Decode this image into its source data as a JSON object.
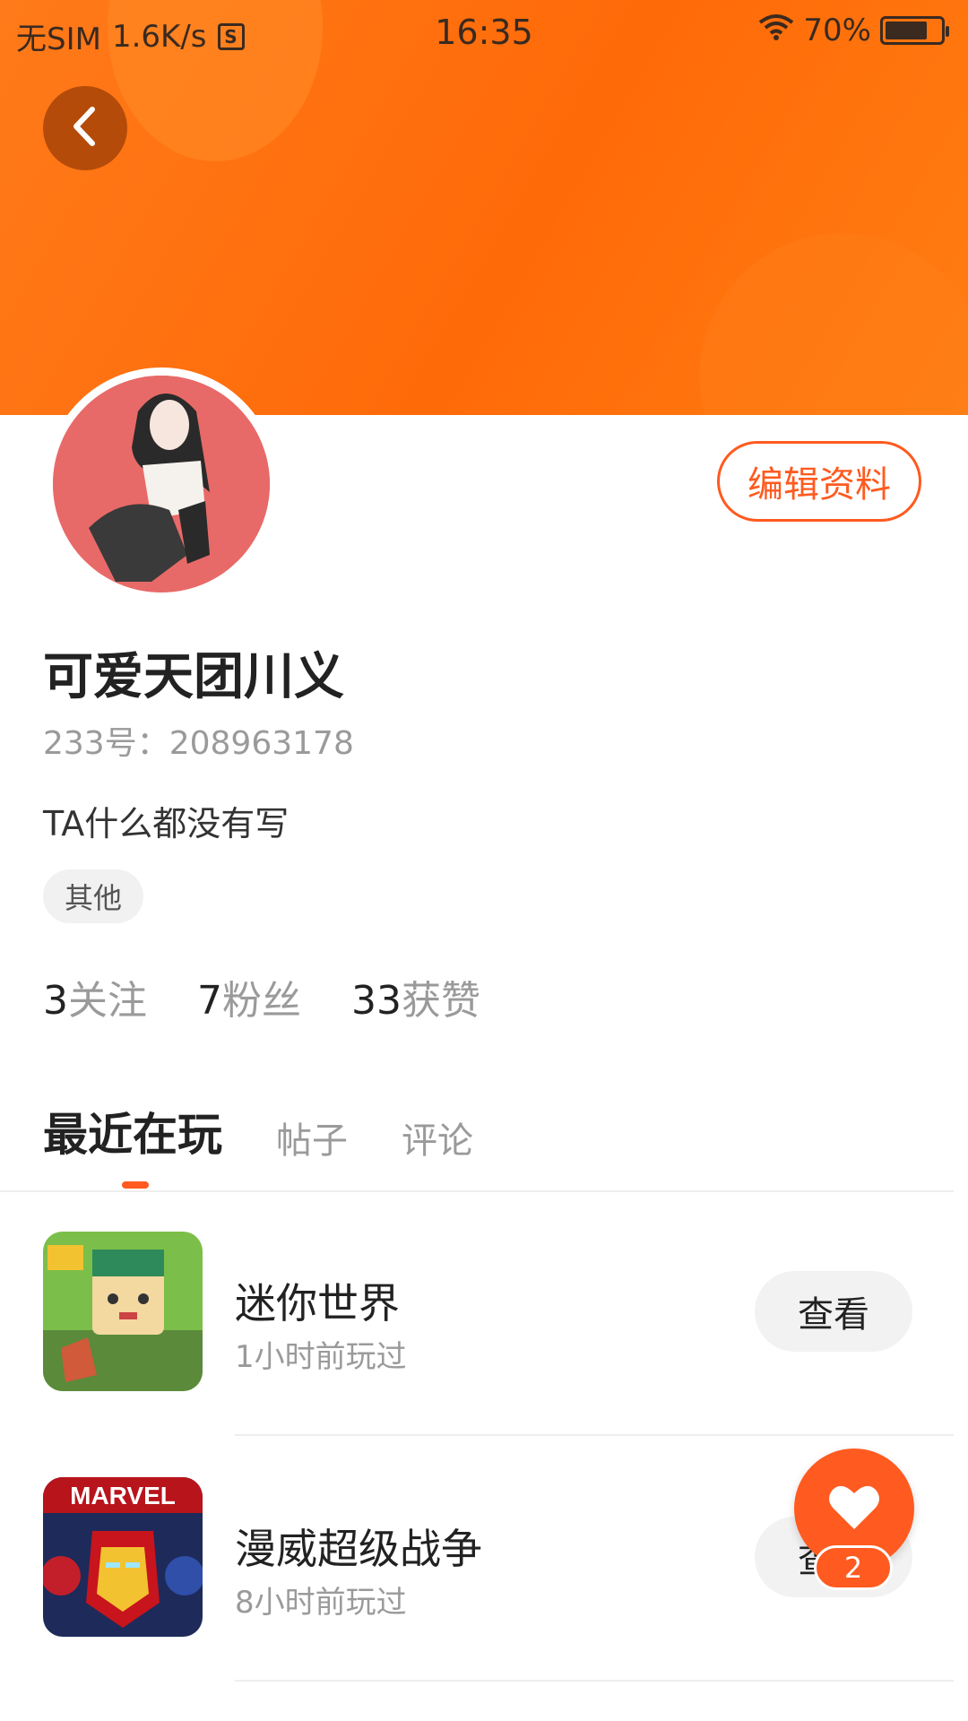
{
  "status_bar": {
    "carrier": "无SIM",
    "speed": "1.6K/s",
    "sim_icon_letter": "S",
    "time": "16:35",
    "battery": "70%",
    "icons": [
      "wifi-icon",
      "battery-icon",
      "sim-icon"
    ]
  },
  "header": {
    "back_icon": "chevron-left-icon",
    "accent_color": "#ff6a08"
  },
  "profile": {
    "edit_label": "编辑资料",
    "username": "可爱天团川义",
    "uid": "233号：208963178",
    "bio": "TA什么都没有写",
    "tag": "其他",
    "stats": [
      {
        "num": "3",
        "label": "关注"
      },
      {
        "num": "7",
        "label": "粉丝"
      },
      {
        "num": "33",
        "label": "获赞"
      }
    ]
  },
  "tabs": [
    {
      "label": "最近在玩",
      "active": true
    },
    {
      "label": "帖子",
      "active": false
    },
    {
      "label": "评论",
      "active": false
    }
  ],
  "games": [
    {
      "name": "迷你世界",
      "played": "1小时前玩过",
      "action": "查看",
      "icon": "mini-world-icon"
    },
    {
      "name": "漫威超级战争",
      "played": "8小时前玩过",
      "action": "查看",
      "icon": "marvel-icon",
      "icon_text": "MARVEL"
    }
  ],
  "fab": {
    "icon": "heart-icon",
    "badge": "2",
    "color": "#ff5a1f"
  }
}
